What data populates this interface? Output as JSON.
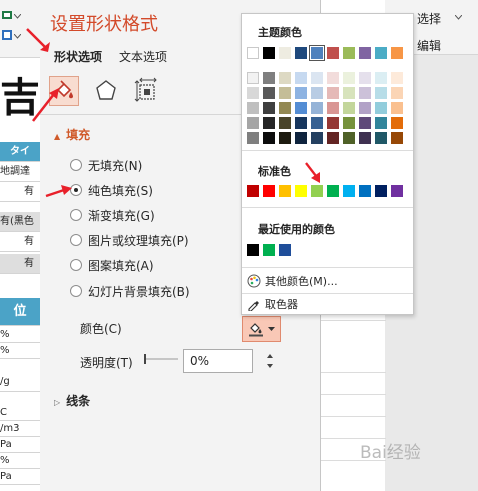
{
  "pane": {
    "title": "设置形状格式",
    "tabs": [
      "形状选项",
      "文本选项"
    ],
    "fill_section": "填充",
    "fill_options": [
      "无填充(N)",
      "纯色填充(S)",
      "渐变填充(G)",
      "图片或纹理填充(P)",
      "图案填充(A)",
      "幻灯片背景填充(B)"
    ],
    "selected_fill": "纯色填充(S)",
    "color_label": "颜色(C)",
    "transparency_label": "透明度(T)",
    "transparency_value": "0%",
    "line_section": "线条"
  },
  "palette": {
    "theme_heading": "主题颜色",
    "theme_top": [
      "#ffffff",
      "#000000",
      "#e7e6e6",
      "#44546a",
      "#4472c4",
      "#ed7d31",
      "#a5a5a5",
      "#ffc000",
      "#5b9bd5",
      "#70ad47"
    ],
    "theme_top_shown": [
      "#ffffff",
      "#000000",
      "#eeece1",
      "#1f497d",
      "#4f81bd",
      "#c0504d",
      "#9bbb59",
      "#8064a2",
      "#4bacc6",
      "#f79646"
    ],
    "theme_tints": [
      [
        "#f2f2f2",
        "#7f7f7f",
        "#ddd9c3",
        "#c6d9f0",
        "#dbe5f1",
        "#f2dcdb",
        "#ebf1dd",
        "#e5e0ec",
        "#dbeef3",
        "#fdeada"
      ],
      [
        "#d8d8d8",
        "#595959",
        "#c4bd97",
        "#8db3e2",
        "#b8cce4",
        "#e5b9b7",
        "#d7e3bc",
        "#ccc1d9",
        "#b7dde8",
        "#fbd5b5"
      ],
      [
        "#bfbfbf",
        "#3f3f3f",
        "#938953",
        "#548dd4",
        "#95b3d7",
        "#d99694",
        "#c3d69b",
        "#b2a2c7",
        "#92cddc",
        "#fac08f"
      ],
      [
        "#a5a5a5",
        "#262626",
        "#494429",
        "#17365d",
        "#366092",
        "#953734",
        "#76923c",
        "#5f497a",
        "#31859b",
        "#e36c09"
      ],
      [
        "#7f7f7f",
        "#0c0c0c",
        "#1d1b10",
        "#0f243e",
        "#244061",
        "#632423",
        "#4f6128",
        "#3f3151",
        "#205867",
        "#974806"
      ]
    ],
    "standard_heading": "标准色",
    "standard": [
      "#c00000",
      "#ff0000",
      "#ffc000",
      "#ffff00",
      "#92d050",
      "#00b050",
      "#00b0f0",
      "#0070c0",
      "#002060",
      "#7030a0"
    ],
    "recent_heading": "最近使用的颜色",
    "recent": [
      "#000000",
      "#00b050",
      "#1f4e9a"
    ],
    "more_colors": "其他颜色(M)...",
    "eyedropper": "取色器"
  },
  "sheet": {
    "big_char": "吉果",
    "rows": [
      "タイ",
      "地調達",
      "有",
      "有(黒色",
      "有",
      "有"
    ],
    "header2": "位",
    "rows2": [
      "%",
      "%",
      "/g",
      "C",
      "/m3",
      "Pa",
      "%",
      "Pa"
    ]
  },
  "ribbon_right": {
    "select": "选择",
    "edit": "编辑"
  },
  "watermark": "Bai经验",
  "colors": {
    "accent_title": "#d34a2a",
    "fill_heading": "#d05a2a",
    "sheet_header": "#4ba3c7",
    "annotation": "#e8202a"
  }
}
